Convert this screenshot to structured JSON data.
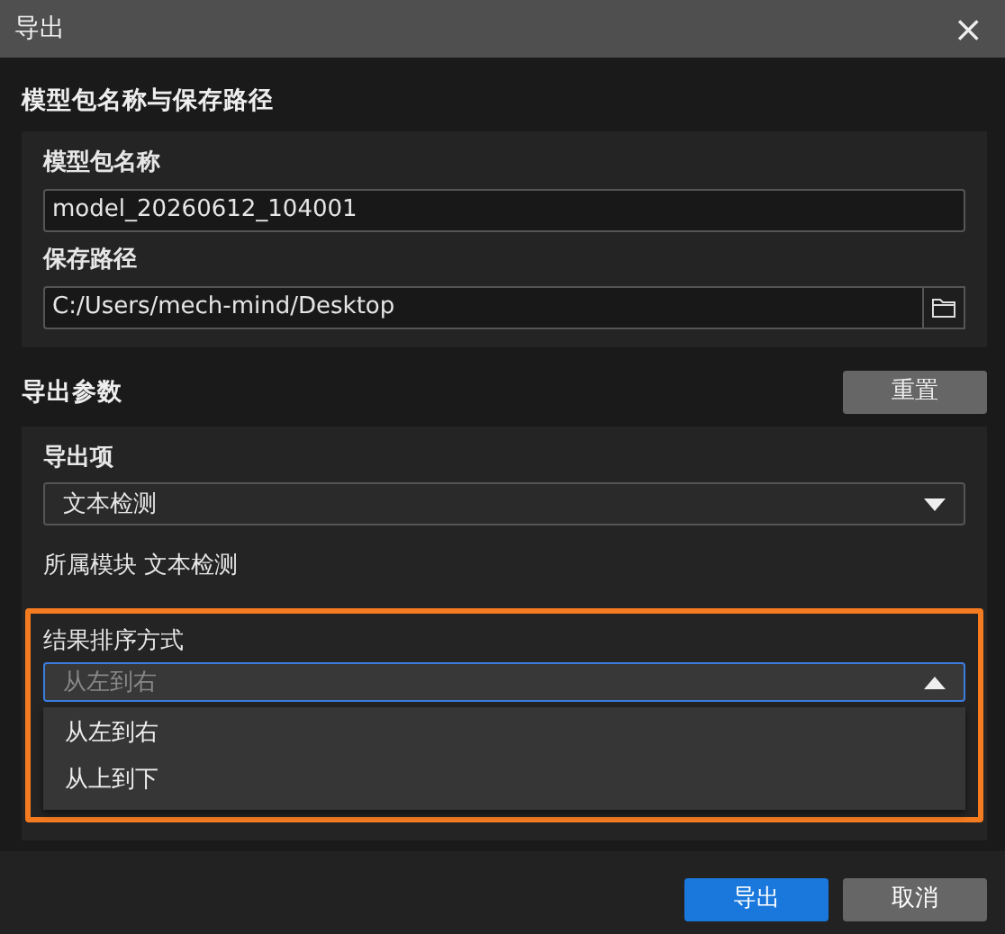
{
  "window": {
    "title": "导出",
    "close": "×"
  },
  "sections": [
    {
      "heading": "模型包名称与保存路径",
      "fields": [
        {
          "kind": "text",
          "label": "模型包名称",
          "value": "model_20260612_104001"
        },
        {
          "kind": "path",
          "label": "保存路径",
          "value": "C:/Users/mech-mind/Desktop"
        }
      ]
    },
    {
      "heading": "导出参数",
      "reset_button": "重置",
      "fields": [
        {
          "kind": "select",
          "label": "导出项",
          "value": "文本检测",
          "expanded": false
        },
        {
          "kind": "info",
          "label": "所属模块",
          "value": "文本检测"
        },
        {
          "kind": "select",
          "label": "结果排序方式",
          "placeholder": "从左到右",
          "expanded": true,
          "highlighted": true,
          "options": [
            {
              "label": "从左到右",
              "selected": false
            },
            {
              "label": "从上到下",
              "selected": false
            }
          ]
        }
      ]
    }
  ],
  "buttons": [
    {
      "label": "导出",
      "kind": "primary"
    },
    {
      "label": "取消",
      "kind": "secondary"
    }
  ]
}
